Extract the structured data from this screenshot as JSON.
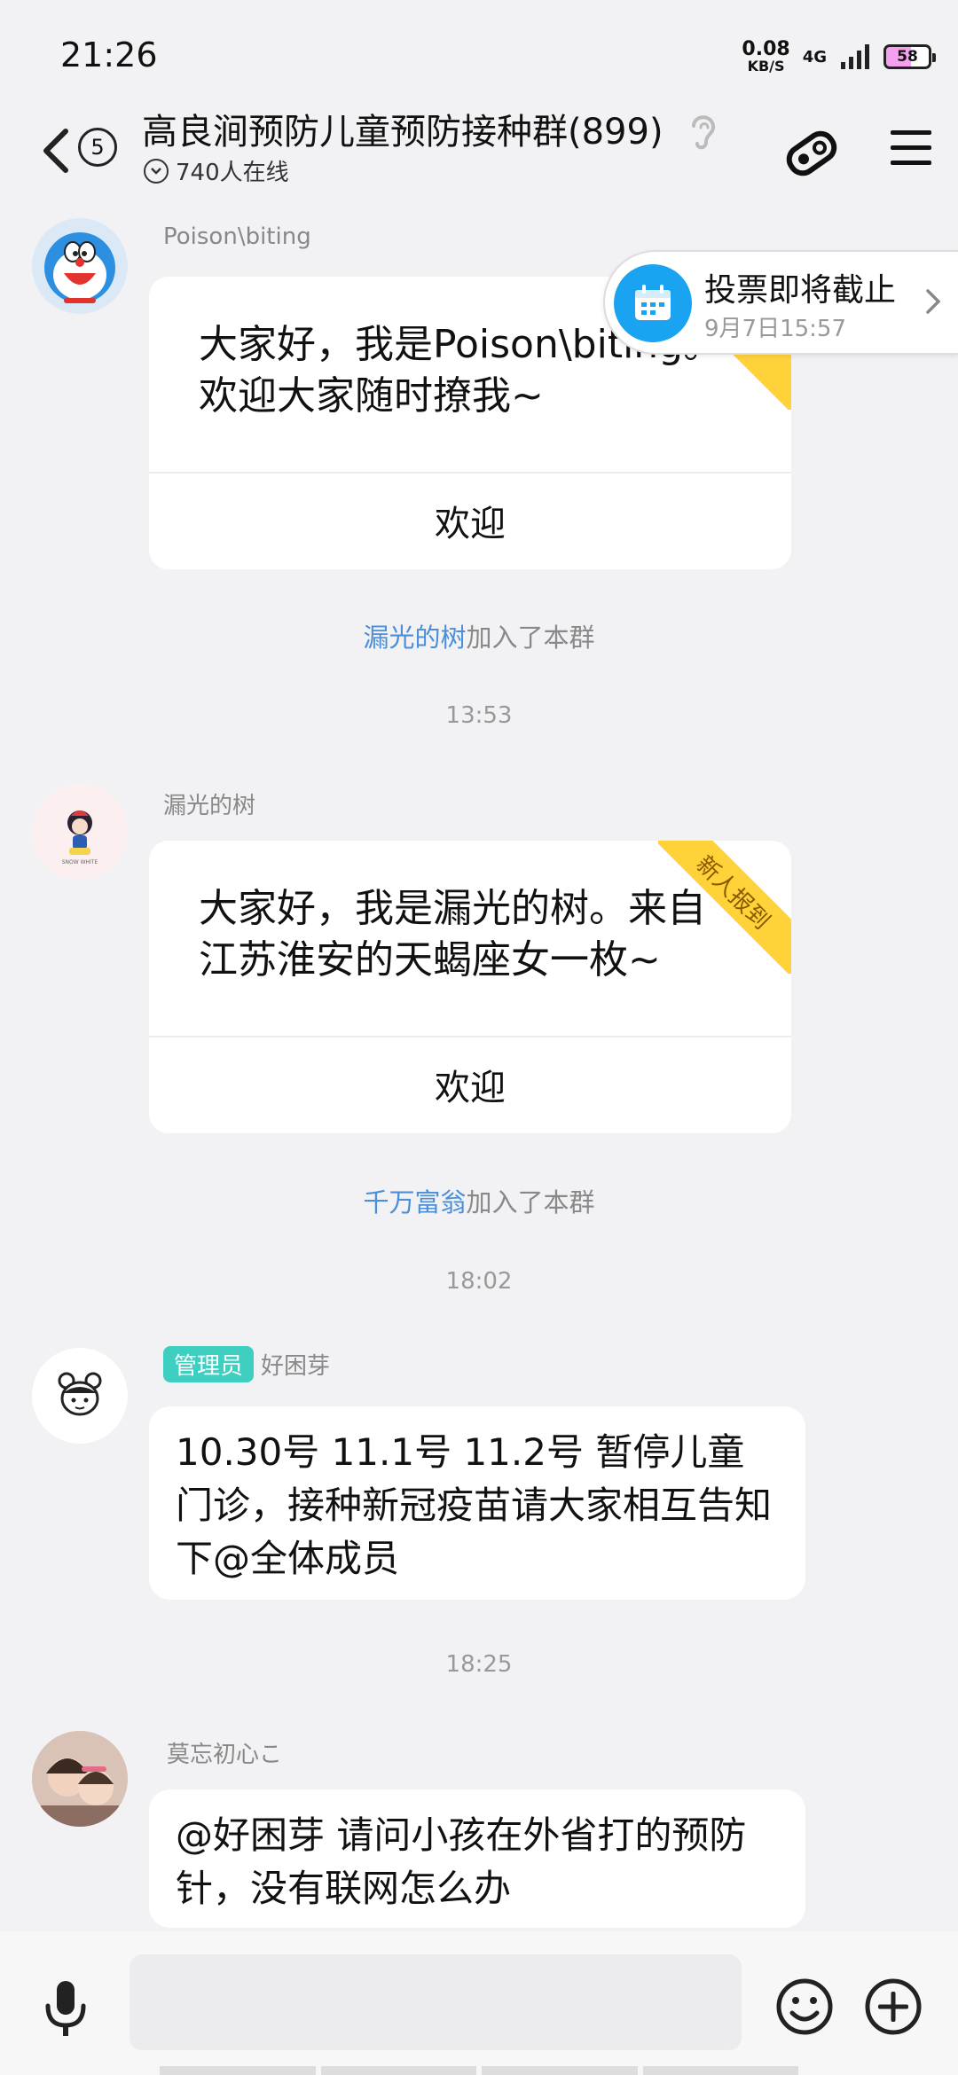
{
  "status_bar": {
    "time": "21:26",
    "net_speed_value": "0.08",
    "net_speed_unit": "KB/S",
    "network": "4G",
    "battery": "58"
  },
  "header": {
    "unread_count": "5",
    "group_title": "高良涧预防儿童预防接种群(899)",
    "online_text": "740人在线"
  },
  "vote_banner": {
    "title": "投票即将截止",
    "subtitle": "9月7日15:57"
  },
  "messages": {
    "m1": {
      "sender": "Poison\\biting",
      "text": "大家好，我是Poison\\biting。欢迎大家随时撩我~",
      "action": "欢迎"
    },
    "sys1": {
      "name": "漏光的树",
      "suffix": "加入了本群"
    },
    "time1": "13:53",
    "m2": {
      "sender": "漏光的树",
      "ribbon": "新人报到",
      "text": "大家好，我是漏光的树。来自江苏淮安的天蝎座女一枚~",
      "action": "欢迎"
    },
    "sys2": {
      "name": "千万富翁",
      "suffix": "加入了本群"
    },
    "time2": "18:02",
    "m3": {
      "badge": "管理员",
      "sender": "好困芽",
      "text": "10.30号 11.1号 11.2号 暂停儿童门诊，接种新冠疫苗请大家相互告知下@全体成员"
    },
    "time3": "18:25",
    "m4": {
      "sender": "莫忘初心こ",
      "text": "@好困芽 请问小孩在外省打的预防针，没有联网怎么办"
    }
  },
  "colors": {
    "link": "#4a8fd8",
    "admin_badge": "#3fcfc1",
    "ribbon": "#ffd23a",
    "vote_icon": "#1aa3f0"
  }
}
